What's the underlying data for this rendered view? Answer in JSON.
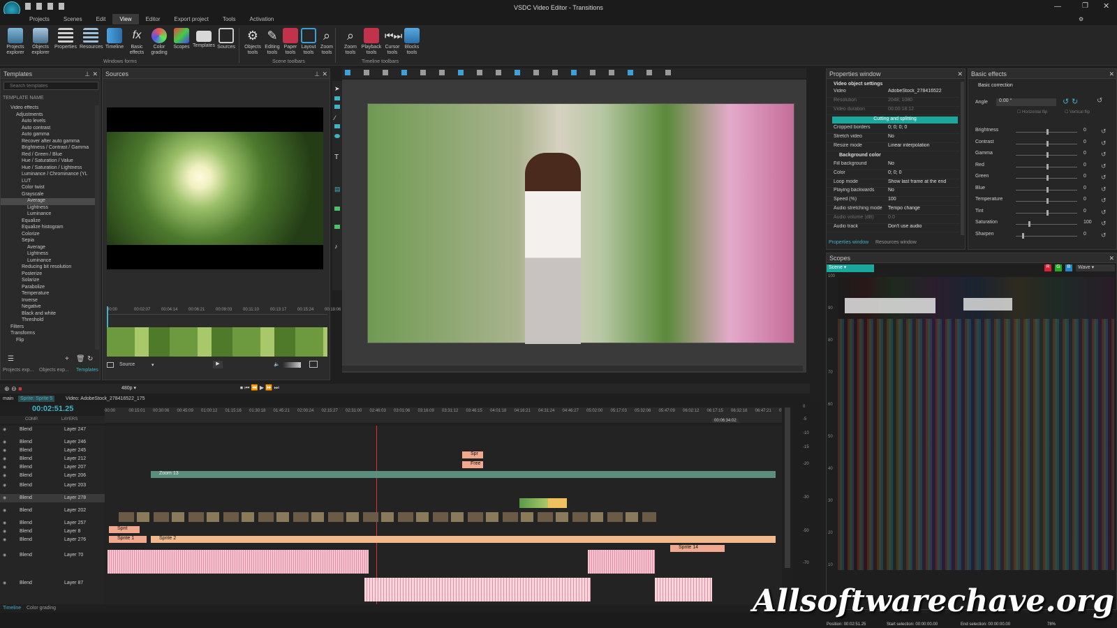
{
  "window": {
    "title": "VSDC Video Editor - Transitions",
    "options_label": "Options"
  },
  "menu": [
    "Projects",
    "Scenes",
    "Edit",
    "View",
    "Editor",
    "Export project",
    "Tools",
    "Activation"
  ],
  "ribbon": {
    "buttons": [
      {
        "label": "Projects explorer",
        "icon": "projects-icon"
      },
      {
        "label": "Objects explorer",
        "icon": "objects-icon"
      },
      {
        "label": "Properties",
        "icon": "properties-icon"
      },
      {
        "label": "Resources",
        "icon": "resources-icon"
      },
      {
        "label": "Timeline",
        "icon": "timeline-icon"
      },
      {
        "label": "Basic effects",
        "icon": "fx-icon"
      },
      {
        "label": "Color grading",
        "icon": "color-grading-icon"
      },
      {
        "label": "Scopes",
        "icon": "scopes-icon"
      },
      {
        "label": "Templates",
        "icon": "folder-icon"
      },
      {
        "label": "Sources",
        "icon": "sources-icon"
      },
      {
        "label": "Objects tools",
        "icon": "gear-icon"
      },
      {
        "label": "Editing tools",
        "icon": "pen-icon"
      },
      {
        "label": "Paper tools",
        "icon": "paper-icon"
      },
      {
        "label": "Layout tools",
        "icon": "layout-icon"
      },
      {
        "label": "Zoom tools",
        "icon": "zoom-icon"
      },
      {
        "label": "Zoom tools",
        "icon": "zoom-icon"
      },
      {
        "label": "Playback tools",
        "icon": "playback-icon"
      },
      {
        "label": "Cursor tools",
        "icon": "cursor-icon"
      },
      {
        "label": "Blocks tools",
        "icon": "blocks-icon"
      }
    ],
    "groups": [
      "Windows forms",
      "Scene toolbars",
      "Timeline toolbars"
    ]
  },
  "templates": {
    "title": "Templates",
    "search_placeholder": "Search templates",
    "column": "TEMPLATE NAME",
    "items": [
      "Video effects",
      "Adjustments",
      "Auto levels",
      "Auto contrast",
      "Auto gamma",
      "Recover after auto gamma",
      "Brightness / Contrast / Gamma",
      "Red / Green / Blue",
      "Hue / Saturation / Value",
      "Hue / Saturation / Lightness",
      "Luminance / Chrominance (YL",
      "LUT",
      "Color twist",
      "Grayscale",
      "Average",
      "Lightness",
      "Luminance",
      "Equalize",
      "Equalize histogram",
      "Colorize",
      "Sepia",
      "Average",
      "Lightness",
      "Luminance",
      "Reducing bit resolution",
      "Posterize",
      "Solarize",
      "Parabolize",
      "Temperature",
      "Inverse",
      "Negative",
      "Black and white",
      "Threshold",
      "Filters",
      "Transforms",
      "Flip"
    ],
    "bottom_tabs": [
      "Projects exp...",
      "Objects exp...",
      "Templates"
    ]
  },
  "sources": {
    "title": "Sources",
    "ruler": [
      "00:00",
      "00:02:07",
      "00:04:14",
      "00:06:21",
      "00:09:03",
      "00:11:10",
      "00:13:17",
      "00:15:24",
      "00:18:06"
    ],
    "dropdown": "Source"
  },
  "properties": {
    "title": "Properties window",
    "section": "Video object settings",
    "rows": [
      {
        "k": "Video",
        "v": "AdobeStock_278416522",
        "dim": false
      },
      {
        "k": "Resolution",
        "v": "2048; 1080",
        "dim": true
      },
      {
        "k": "Video duration",
        "v": "00:00:18:12",
        "dim": true
      }
    ],
    "button": "Cutting and splitting",
    "rows2": [
      {
        "k": "Cropped borders",
        "v": "0; 0; 0; 0",
        "dim": false
      },
      {
        "k": "Stretch video",
        "v": "No",
        "dim": false
      },
      {
        "k": "Resize mode",
        "v": "Linear interpolation",
        "dim": false
      }
    ],
    "bg_section": "Background color",
    "rows3": [
      {
        "k": "Fill background",
        "v": "No",
        "dim": false
      },
      {
        "k": "Color",
        "v": "0; 0; 0",
        "dim": false
      },
      {
        "k": "Loop mode",
        "v": "Show last frame at the end",
        "dim": false
      },
      {
        "k": "Playing backwards",
        "v": "No",
        "dim": false
      },
      {
        "k": "Speed (%)",
        "v": "100",
        "dim": false
      },
      {
        "k": "Audio stretching mode",
        "v": "Tempo change",
        "dim": false
      },
      {
        "k": "Audio volume (dB)",
        "v": "0.0",
        "dim": true
      },
      {
        "k": "Audio track",
        "v": "Don't use audio",
        "dim": false
      }
    ],
    "tabs": [
      "Properties window",
      "Resources window"
    ]
  },
  "basic_effects": {
    "title": "Basic effects",
    "section": "Basic correction",
    "angle_label": "Angle",
    "angle_value": "0.00 °",
    "hflip": "Horizontal flip",
    "vflip": "Vertical flip",
    "sliders": [
      {
        "name": "Brightness",
        "value": "0",
        "level": 0.5
      },
      {
        "name": "Contrast",
        "value": "0",
        "level": 0.5
      },
      {
        "name": "Gamma",
        "value": "0",
        "level": 0.5
      },
      {
        "name": "Red",
        "value": "0",
        "level": 0.5
      },
      {
        "name": "Green",
        "value": "0",
        "level": 0.5
      },
      {
        "name": "Blue",
        "value": "0",
        "level": 0.5
      },
      {
        "name": "Temperature",
        "value": "0",
        "level": 0.5
      },
      {
        "name": "Tint",
        "value": "0",
        "level": 0.5
      },
      {
        "name": "Saturation",
        "value": "100",
        "level": 0.2
      },
      {
        "name": "Sharpen",
        "value": "0",
        "level": 0.1
      }
    ]
  },
  "scopes": {
    "title": "Scopes",
    "mode": "Scene",
    "type": "Wave",
    "channels": [
      "R",
      "G",
      "B"
    ],
    "y_labels": [
      "100",
      "90",
      "80",
      "70",
      "60",
      "50",
      "40",
      "30",
      "20",
      "10"
    ]
  },
  "timeline": {
    "tabs": [
      "main",
      "Sprite: Sprite 5",
      "Video: AdobeStock_278416522_175"
    ],
    "time": "00:02:51.25",
    "resolution": "480p",
    "header_comp": "COMP.",
    "header_layers": "LAYERS",
    "ruler": [
      "00:00",
      "00:15:01",
      "00:30:06",
      "00:45:09",
      "01:00:12",
      "01:15:16",
      "01:30:18",
      "01:45:21",
      "02:00:24",
      "02:15:27",
      "02:31:00",
      "02:46:03",
      "03:01:06",
      "03:16:09",
      "03:31:12",
      "03:46:15",
      "04:01:18",
      "04:16:21",
      "04:31:24",
      "04:46:27",
      "05:02:00",
      "05:17:03",
      "05:32:06",
      "05:47:09",
      "06:02:12",
      "06:17:15",
      "06:32:18",
      "06:47:21",
      "07:02:24"
    ],
    "cursor_time": "00:06:34:02",
    "rows": [
      {
        "blend": "Blend",
        "layer": "Layer 247"
      },
      {
        "blend": "Blend",
        "layer": "Layer 246"
      },
      {
        "blend": "Blend",
        "layer": "Layer 245"
      },
      {
        "blend": "Blend",
        "layer": "Layer 212"
      },
      {
        "blend": "Blend",
        "layer": "Layer 207"
      },
      {
        "blend": "Blend",
        "layer": "Layer 206"
      },
      {
        "blend": "Blend",
        "layer": "Layer 203"
      },
      {
        "blend": "Blend",
        "layer": "Layer 278"
      },
      {
        "blend": "Blend",
        "layer": "Layer 202"
      },
      {
        "blend": "Blend",
        "layer": "Layer 257"
      },
      {
        "blend": "Blend",
        "layer": "Layer 8"
      },
      {
        "blend": "Blend",
        "layer": "Layer 276"
      },
      {
        "blend": "Blend",
        "layer": "Layer 70"
      },
      {
        "blend": "Blend",
        "layer": "Layer 87"
      }
    ],
    "clips": {
      "zoom": "Zoom 13",
      "spr": "Spr",
      "free": "Free",
      "sprit": "Sprit",
      "sprite1": "Sprite 1",
      "sprite2": "Sprite 2",
      "sprite14": "Sprite 14"
    },
    "meter": [
      "0",
      "-5",
      "-10",
      "-15",
      "-20",
      "-30",
      "-50",
      "-70"
    ],
    "bottom_tabs": [
      "Timeline",
      "Color grading"
    ]
  },
  "status": {
    "position_label": "Position:",
    "position": "00:02:51.25",
    "start_label": "Start selection:",
    "start": "00:00:00.00",
    "end_label": "End selection:",
    "end": "00:00:00.00",
    "zoom": "78%"
  },
  "watermark": "Allsoftwarechave.org"
}
